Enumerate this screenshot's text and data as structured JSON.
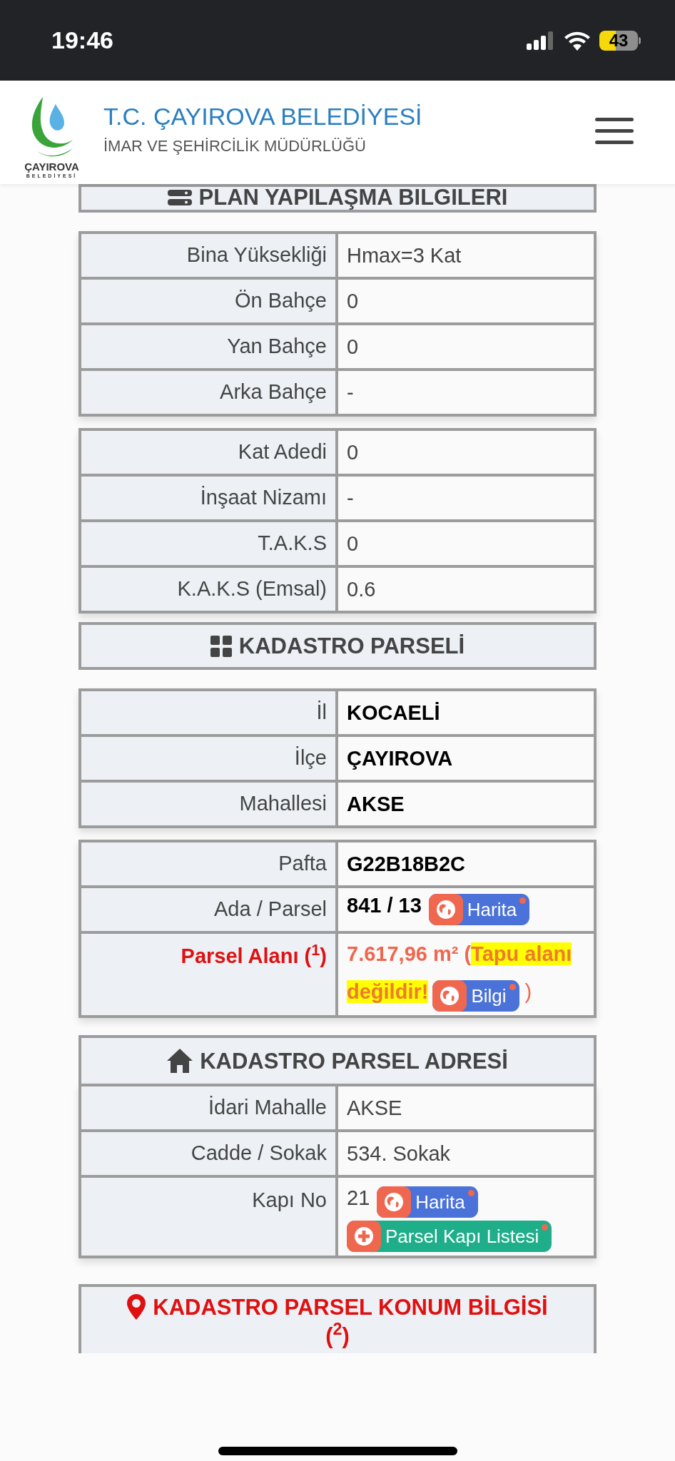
{
  "status_bar": {
    "time": "19:46",
    "battery": "43"
  },
  "header": {
    "logo_name": "ÇAYIROVA",
    "logo_sub": "BELEDİYESİ",
    "title": "T.C. ÇAYIROVA BELEDİYESİ",
    "subtitle": "İMAR VE ŞEHİRCİLİK MÜDÜRLÜĞÜ"
  },
  "sections": [
    {
      "kind": "plan",
      "title": "PLAN YAPILAŞMA BILGILERI",
      "tables": [
        {
          "rows": [
            {
              "label": "Bina Yüksekliği",
              "value": "Hmax=3 Kat",
              "kind": "plain"
            },
            {
              "label": "Ön Bahçe",
              "value": "0",
              "kind": "plain"
            },
            {
              "label": "Yan Bahçe",
              "value": "0",
              "kind": "plain"
            },
            {
              "label": "Arka Bahçe",
              "value": "-",
              "kind": "plain"
            }
          ]
        },
        {
          "rows": [
            {
              "label": "Kat Adedi",
              "value": "0",
              "kind": "plain"
            },
            {
              "label": "İnşaat Nizamı",
              "value": "-",
              "kind": "plain"
            },
            {
              "label": "T.A.K.S",
              "value": "0",
              "kind": "plain"
            },
            {
              "label": "K.A.K.S (Emsal)",
              "value": "0.6",
              "kind": "plain"
            }
          ]
        }
      ]
    },
    {
      "kind": "parcel",
      "title": "KADASTRO PARSELİ",
      "tables": [
        {
          "rows": [
            {
              "label": "İl",
              "value": "KOCAELİ",
              "kind": "bold"
            },
            {
              "label": "İlçe",
              "value": "ÇAYIROVA",
              "kind": "bold"
            },
            {
              "label": "Mahallesi",
              "value": "AKSE",
              "kind": "bold"
            }
          ]
        },
        {
          "rows": [
            {
              "label": "Pafta",
              "value": "G22B18B2C",
              "kind": "bold"
            },
            {
              "label": "Ada / Parsel",
              "value": "841 / 13",
              "kind": "bold",
              "buttons": [
                {
                  "label": "Harita",
                  "kind": "map"
                }
              ]
            },
            {
              "label": "Parsel Alanı ($^{1}$)",
              "value": "7.617,96 m² (",
              "kind": "warning",
              "highlight": "Tapu alanı değildir!",
              "buttons": [
                {
                  "label": "Bilgi",
                  "kind": "map"
                }
              ],
              "suffix": ")"
            }
          ]
        }
      ]
    },
    {
      "kind": "address",
      "title": "KADASTRO PARSEL ADRESİ",
      "tables": [
        {
          "rows": [
            {
              "label": "İdari Mahalle",
              "value": "AKSE",
              "kind": "plain"
            },
            {
              "label": "Cadde / Sokak",
              "value": "534. Sokak",
              "kind": "plain"
            },
            {
              "label": "Kapı No",
              "value": "21",
              "kind": "plain",
              "buttons": [
                {
                  "label": "Harita",
                  "kind": "map"
                },
                {
                  "label": "Parsel Kapı Listesi",
                  "kind": "list"
                }
              ]
            }
          ]
        }
      ]
    },
    {
      "kind": "location",
      "title": "KADASTRO PARSEL KONUM BİLGİSİ",
      "note": "($^{2}$)"
    }
  ]
}
